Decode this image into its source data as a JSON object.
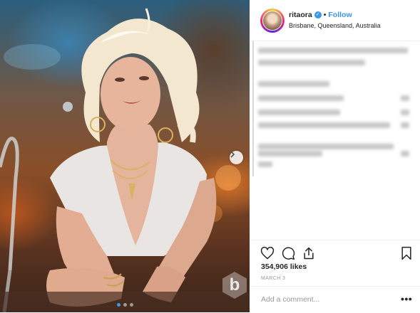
{
  "post": {
    "images_total": 3,
    "current_image": 1
  },
  "header": {
    "username": "ritaora",
    "separator": "•",
    "follow_label": "Follow",
    "location": "Brisbane, Queensland, Australia",
    "verified": true
  },
  "watermark": {
    "letter": "b"
  },
  "stats": {
    "likes": "354,906 likes",
    "date": "MARCH 3"
  },
  "comment": {
    "placeholder": "Add a comment...",
    "more_label": "•••"
  },
  "icons": {
    "like": "heart-icon",
    "comment": "comment-bubble-icon",
    "share": "share-icon",
    "save": "bookmark-icon",
    "next": "chevron-right-icon",
    "verified": "verified-check-icon"
  },
  "colors": {
    "accent": "#3897f0",
    "text": "#262626",
    "muted": "#999999",
    "divider": "#efefef"
  }
}
